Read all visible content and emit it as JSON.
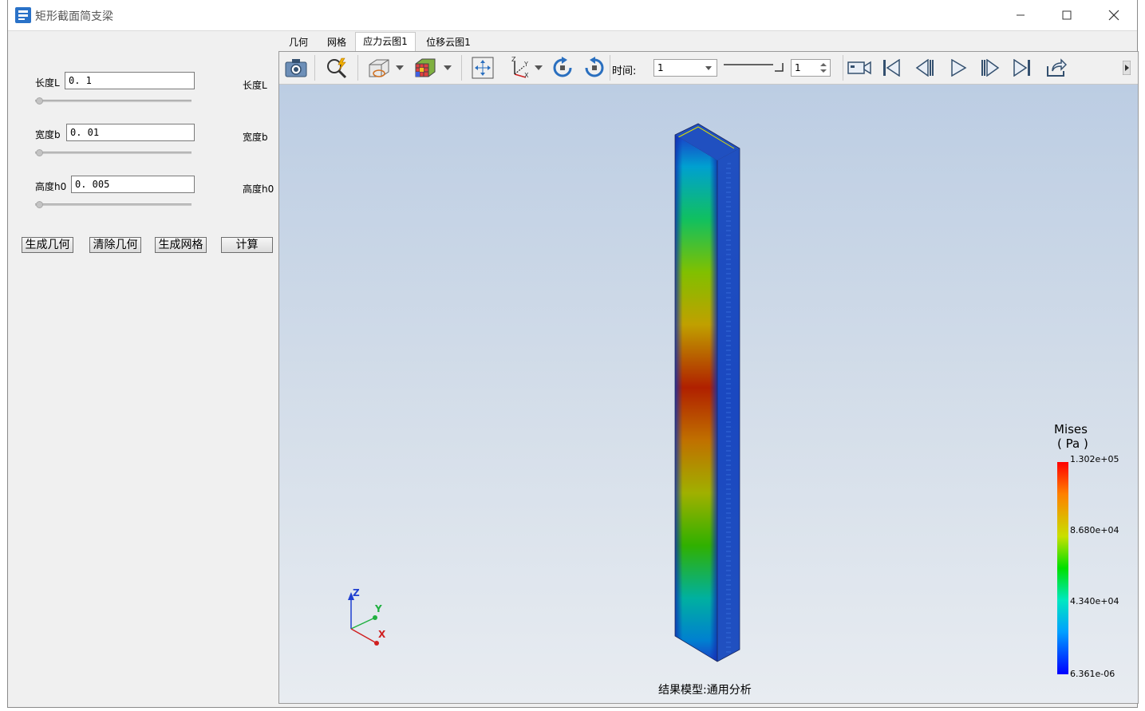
{
  "window": {
    "title": "矩形截面简支梁"
  },
  "params": [
    {
      "label": "长度L",
      "value": "0. 1",
      "right_label": "长度L",
      "slider_level": 0
    },
    {
      "label": "宽度b",
      "value": "0. 01",
      "right_label": "宽度b",
      "slider_level": 0
    },
    {
      "label": "高度h0",
      "value": "0. 005",
      "right_label": "高度h0",
      "slider_level": 0
    }
  ],
  "buttons": {
    "gen_geometry": "生成几何",
    "clear_geometry": "清除几何",
    "gen_mesh": "生成网格",
    "compute": "计算"
  },
  "tabs": [
    {
      "label": "几何",
      "active": false
    },
    {
      "label": "网格",
      "active": false
    },
    {
      "label": "应力云图1",
      "active": true
    },
    {
      "label": "位移云图1",
      "active": false
    }
  ],
  "toolbar": {
    "time_label": "时间:",
    "time_value": "1",
    "step_value": "1",
    "icons": [
      "camera-icon",
      "zoom-fit-icon",
      "display-mode-icon",
      "color-cube-icon",
      "pan-icon",
      "axes-icon",
      "rotate-cw-icon",
      "rotate-ccw-icon",
      "record-video-icon",
      "first-frame-icon",
      "prev-frame-icon",
      "play-icon",
      "next-frame-icon",
      "last-frame-icon",
      "export-icon"
    ]
  },
  "legend": {
    "title": "Mises",
    "unit": "( Pa )",
    "ticks": [
      "1.302e+05",
      "8.680e+04",
      "4.340e+04",
      "6.361e-06"
    ],
    "colors": [
      "#ff0000",
      "#00e000",
      "#0000ff"
    ]
  },
  "triad": {
    "x": "X",
    "y": "Y",
    "z": "Z"
  },
  "caption": "结果模型:通用分析"
}
